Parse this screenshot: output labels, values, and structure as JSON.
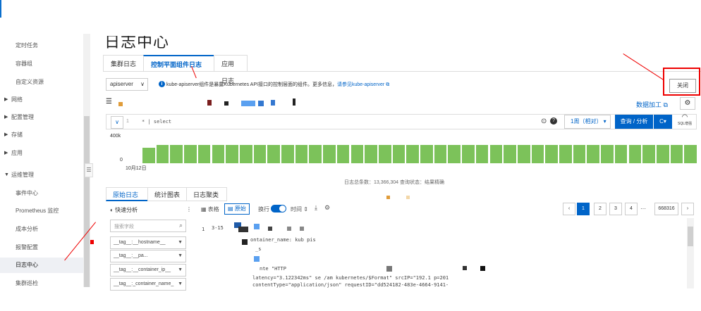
{
  "page_title": "日志中心",
  "sidebar": {
    "items": [
      {
        "label": "定时任务"
      },
      {
        "label": "容器组"
      },
      {
        "label": "自定义资源"
      },
      {
        "label": "网络",
        "group": true
      },
      {
        "label": "配置管理",
        "group": true
      },
      {
        "label": "存储",
        "group": true
      },
      {
        "label": "应用",
        "group": true
      },
      {
        "label": "运维管理",
        "group": true,
        "expanded": true
      },
      {
        "label": "事件中心"
      },
      {
        "label": "Prometheus 监控"
      },
      {
        "label": "成本分析"
      },
      {
        "label": "报警配置"
      },
      {
        "label": "日志中心",
        "active": true
      },
      {
        "label": "集群巡检"
      }
    ]
  },
  "tabs": [
    "集群日志",
    "控制平面组件日志",
    "应用日志"
  ],
  "component_select": "apiserver",
  "info": {
    "text": "kube-apiserver组件是暴露Kubernetes API接口的控制层面的组件。更多信息，",
    "link": "请参见kube-apiserver"
  },
  "close_label": "关闭",
  "data_process_label": "数据加工",
  "query": {
    "line_no": "1",
    "text": "* | select",
    "time_range": "1周（相对）",
    "search_label": "查询 / 分析",
    "sql_label": "SQL增强"
  },
  "chart": {
    "y_top": "400k",
    "y_bottom": "0",
    "x_label": "10月12日",
    "color": "#7cc25a"
  },
  "summary": "日志总条数：13,366,304  查询状态：结果精确",
  "panel_tabs": [
    "原始日志",
    "统计图表",
    "日志聚类"
  ],
  "quick_analysis": "快速分析",
  "field_search_placeholder": "搜索字段",
  "fields": [
    "__tag__:__hostname__",
    "__tag__:__pa...",
    "__tag__:__container_ip__",
    "__tag__:_container_name_"
  ],
  "view_toolbar": {
    "table": "表格",
    "raw": "原始",
    "wrap": "换行",
    "time": "时间"
  },
  "pagination": {
    "pages": [
      "1",
      "2",
      "3",
      "4"
    ],
    "ellipsis": "···",
    "last": "668316"
  },
  "log": {
    "row_no": "1",
    "time": "3-15",
    "lines": [
      "ontainer_name:  kub  pis",
      "_s",
      "nte                                 \"HTTP",
      "latency=\"3.122342ms\"  se         /am   kubernetes/$Format\" srcIP=\"192.1   p=201",
      "contentType=\"application/json\" requestID=\"dd524182-483e-4664-9141-"
    ]
  },
  "accent_color": "#0064c8",
  "annotation_color": "#e00000"
}
